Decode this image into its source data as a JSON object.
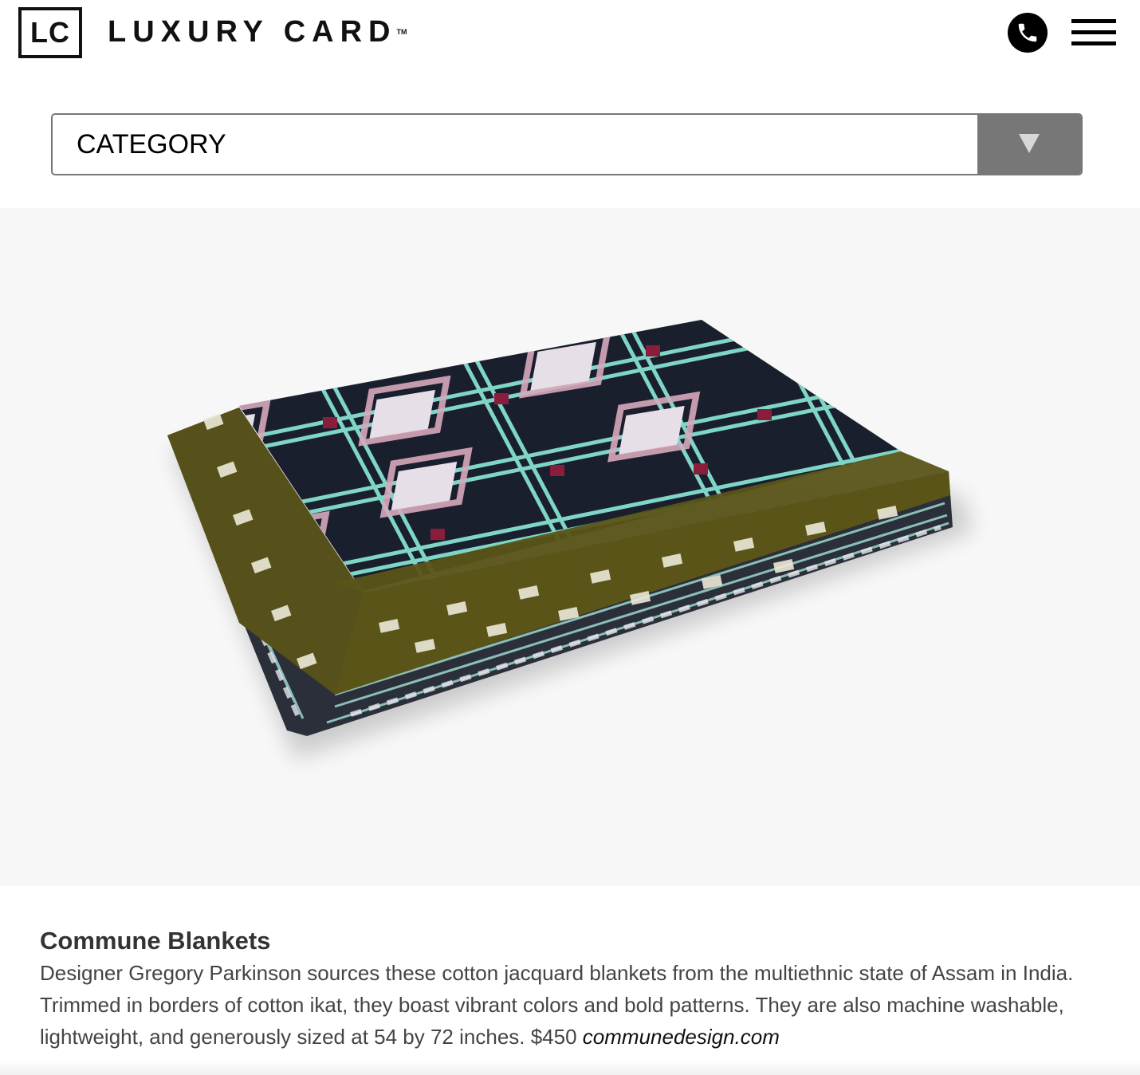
{
  "header": {
    "logo_mark": "LC",
    "logo_text": "LUXURY CARD",
    "logo_tm": "TM",
    "phone_icon": "phone-icon",
    "menu_icon": "hamburger-menu-icon"
  },
  "filter": {
    "category_label": "CATEGORY",
    "arrow_icon": "triangle-down-icon"
  },
  "article": {
    "title": "Commune Blankets",
    "body": "Designer Gregory Parkinson sources these cotton jacquard blankets from the multiethnic state of Assam in India. Trimmed in borders of cotton ikat, they boast vibrant colors and bold patterns. They are also machine washable, lightweight, and generously sized at 54 by 72 inches. $450 ",
    "link_text": "communedesign.com"
  },
  "colors": {
    "hero_bg": "#f7f7f7",
    "select_arrow_bg": "#777777",
    "blanket_navy": "#1a1f2e",
    "blanket_mint": "#7fd6c6",
    "blanket_olive": "#5a5418",
    "blanket_pink": "#d9a9bd",
    "blanket_crimson": "#8a1d3c"
  }
}
